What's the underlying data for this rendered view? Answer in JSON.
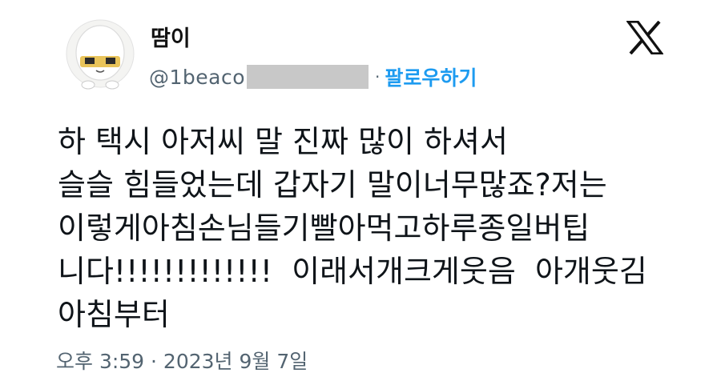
{
  "author": {
    "display_name": "땀이",
    "handle": "@1beaco",
    "follow_label": "팔로우하기",
    "separator": "·"
  },
  "platform": {
    "logo_icon": "x-logo-icon"
  },
  "tweet": {
    "lines": [
      "하 택시 아저씨 말 진짜 많이 하셔서",
      "슬슬 힘들었는데 갑자기 말이너무많죠?저는",
      "이렇게아침손님들기빨아먹고하루종일버팁",
      "니다!!!!!!!!!!!!!  이래서개크게웃음  아개웃김",
      "아침부터"
    ],
    "timestamp": "오후 3:59 · 2023년 9월 7일"
  },
  "colors": {
    "text": "#0f1419",
    "secondary": "#536471",
    "accent": "#1d9bf0",
    "redaction": "#c8c8c8"
  }
}
